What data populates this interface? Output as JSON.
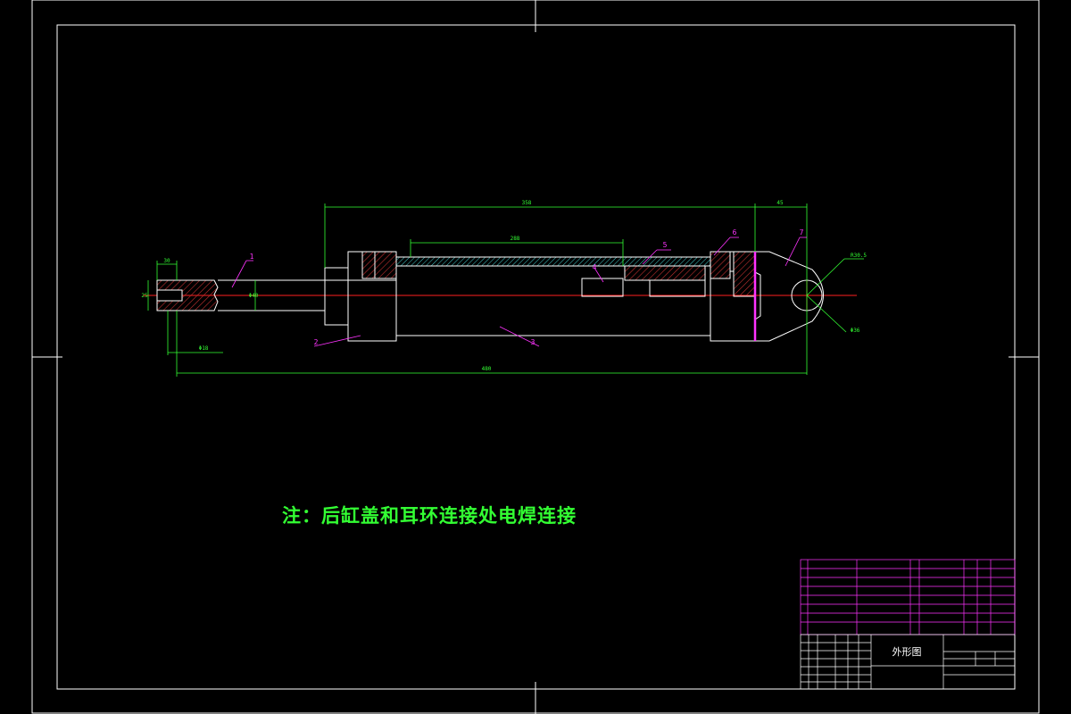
{
  "note": "注：后缸盖和耳环连接处电焊连接",
  "title_block": {
    "drawing_title": "外形图"
  },
  "dimensions": {
    "overall_length": "480",
    "cylinder_length": "358",
    "tube_length": "288",
    "eye_offset": "45",
    "clevis_width": "30",
    "clevis_height": "25",
    "rod_dia": "Φ40",
    "pin_dia": "Φ18",
    "eye_dia": "Φ36",
    "eye_radius": "R30.5"
  },
  "balloons": [
    "1",
    "2",
    "3",
    "4",
    "5",
    "6",
    "7"
  ],
  "colors": {
    "background": "#000000",
    "frame": "#ffffff",
    "dimension": "#33ff33",
    "centerline": "#ff2020",
    "hatch": "#40c8c8",
    "leader": "#ff33ff",
    "note": "#33ff33"
  }
}
